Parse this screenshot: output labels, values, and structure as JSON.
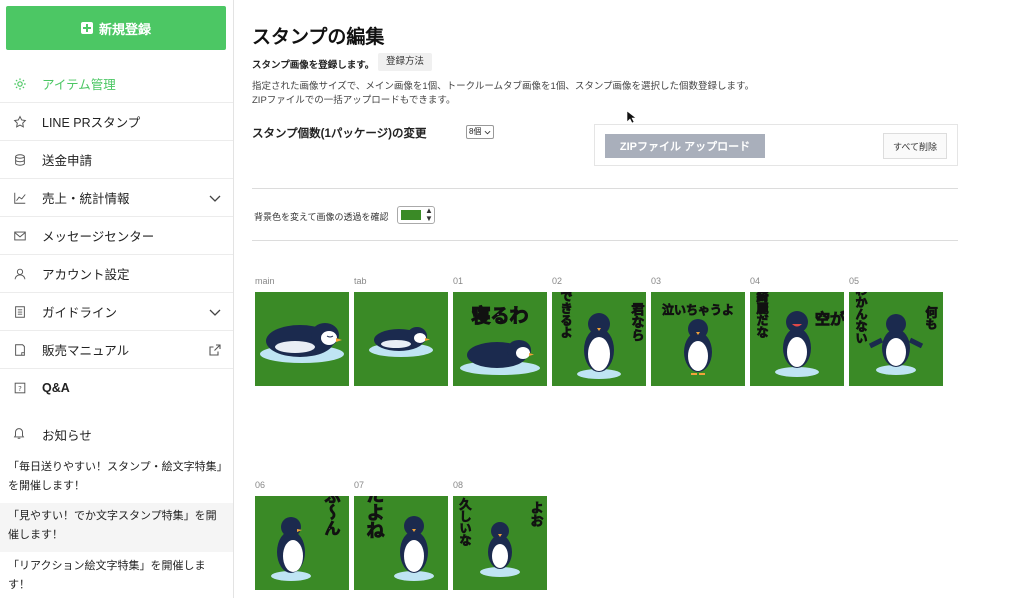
{
  "sidebar": {
    "new_button": "新規登録",
    "items": [
      {
        "label": "アイテム管理",
        "icon": "gear-icon"
      },
      {
        "label": "LINE PRスタンプ",
        "icon": "star-icon"
      },
      {
        "label": "送金申請",
        "icon": "coin-stack-icon"
      },
      {
        "label": "売上・統計情報",
        "icon": "chart-icon"
      },
      {
        "label": "メッセージセンター",
        "icon": "mail-icon"
      },
      {
        "label": "アカウント設定",
        "icon": "user-icon"
      },
      {
        "label": "ガイドライン",
        "icon": "document-icon"
      },
      {
        "label": "販売マニュアル",
        "icon": "book-icon"
      },
      {
        "label": "Q&A",
        "icon": "question-icon"
      }
    ],
    "notice_label": "お知らせ",
    "news": [
      "「毎日送りやすい！スタンプ・絵文字特集」を開催します！",
      "「見やすい！でか文字スタンプ特集」を開催します！",
      "「リアクション絵文字特集」を開催します！"
    ]
  },
  "main": {
    "title": "スタンプの編集",
    "subtitle": "スタンプ画像を登録します。",
    "howto_button": "登録方法",
    "desc_line1": "指定された画像サイズで、メイン画像を1個、トークルームタブ画像を1個、スタンプ画像を選択した個数登録します。",
    "desc_line2": "ZIPファイルでの一括アップロードもできます。",
    "count_label": "スタンプ個数(1パッケージ)の変更",
    "count_value": "8個",
    "zip_button": "ZIPファイル アップロード",
    "delete_all_button": "すべて削除",
    "bg_label": "背景色を変えて画像の透過を確認",
    "bg_color": "#3a8a26",
    "stickers": [
      {
        "label": "main",
        "text": ""
      },
      {
        "label": "tab",
        "text": ""
      },
      {
        "label": "01",
        "text": "寝るわ"
      },
      {
        "label": "02",
        "text": "君なら できるよ"
      },
      {
        "label": "03",
        "text": "泣いちゃうよ"
      },
      {
        "label": "04",
        "text": "空が 綺麗だな"
      },
      {
        "label": "05",
        "text": "何も わかんない"
      },
      {
        "label": "06",
        "text": "ふ〜ん"
      },
      {
        "label": "07",
        "text": "だよね"
      },
      {
        "label": "08",
        "text": "よお 久しいな"
      }
    ]
  }
}
